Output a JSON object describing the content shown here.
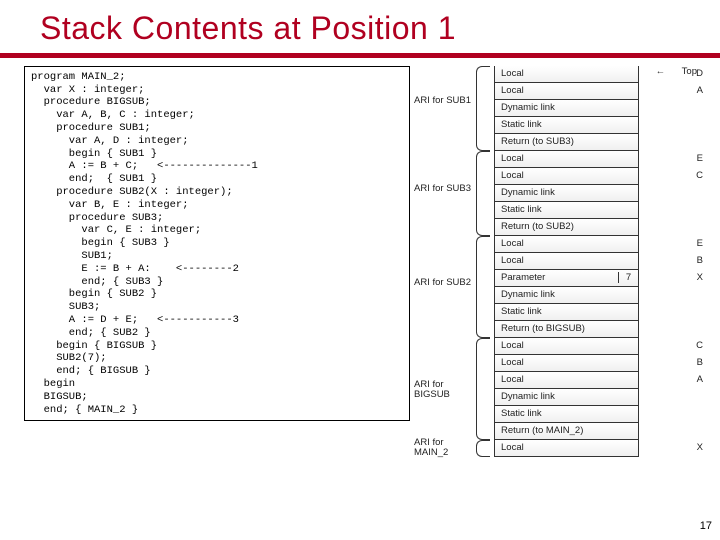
{
  "title": "Stack Contents at Position 1",
  "page_number": "17",
  "code": "program MAIN_2;\n  var X : integer;\n  procedure BIGSUB;\n    var A, B, C : integer;\n    procedure SUB1;\n      var A, D : integer;\n      begin { SUB1 }\n      A := B + C;   <--------------1\n      end;  { SUB1 }\n    procedure SUB2(X : integer);\n      var B, E : integer;\n      procedure SUB3;\n        var C, E : integer;\n        begin { SUB3 }\n        SUB1;\n        E := B + A:    <--------2\n        end; { SUB3 }\n      begin { SUB2 }\n      SUB3;\n      A := D + E;   <-----------3\n      end; { SUB2 }\n    begin { BIGSUB }\n    SUB2(7);\n    end; { BIGSUB }\n  begin\n  BIGSUB;\n  end; { MAIN_2 }",
  "ari_labels": {
    "sub1": "ARI for SUB1",
    "sub3": "ARI for SUB3",
    "sub2": "ARI for SUB2",
    "bigsub": "ARI for BIGSUB",
    "main2": "ARI for MAIN_2"
  },
  "cells": [
    {
      "lab": "Local",
      "val": "",
      "side": "D"
    },
    {
      "lab": "Local",
      "val": "",
      "side": "A"
    },
    {
      "lab": "Dynamic link",
      "val": "",
      "side": ""
    },
    {
      "lab": "Static link",
      "val": "",
      "side": ""
    },
    {
      "lab": "Return (to SUB3)",
      "val": "",
      "side": ""
    },
    {
      "lab": "Local",
      "val": "",
      "side": "E"
    },
    {
      "lab": "Local",
      "val": "",
      "side": "C"
    },
    {
      "lab": "Dynamic link",
      "val": "",
      "side": ""
    },
    {
      "lab": "Static link",
      "val": "",
      "side": ""
    },
    {
      "lab": "Return (to SUB2)",
      "val": "",
      "side": ""
    },
    {
      "lab": "Local",
      "val": "",
      "side": "E"
    },
    {
      "lab": "Local",
      "val": "",
      "side": "B"
    },
    {
      "lab": "Parameter",
      "val": "7",
      "side": "X"
    },
    {
      "lab": "Dynamic link",
      "val": "",
      "side": ""
    },
    {
      "lab": "Static link",
      "val": "",
      "side": ""
    },
    {
      "lab": "Return (to BIGSUB)",
      "val": "",
      "side": ""
    },
    {
      "lab": "Local",
      "val": "",
      "side": "C"
    },
    {
      "lab": "Local",
      "val": "",
      "side": "B"
    },
    {
      "lab": "Local",
      "val": "",
      "side": "A"
    },
    {
      "lab": "Dynamic link",
      "val": "",
      "side": ""
    },
    {
      "lab": "Static link",
      "val": "",
      "side": ""
    },
    {
      "lab": "Return (to MAIN_2)",
      "val": "",
      "side": ""
    },
    {
      "lab": "Local",
      "val": "",
      "side": "X"
    }
  ],
  "top_label": "Top"
}
